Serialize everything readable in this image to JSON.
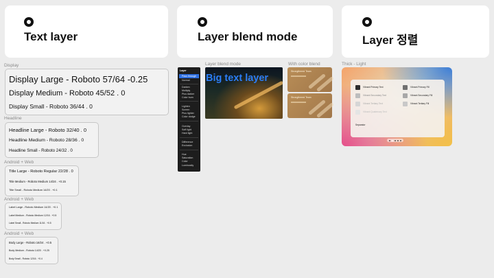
{
  "cards": [
    {
      "title": "Text layer"
    },
    {
      "title": "Layer blend mode"
    },
    {
      "title": "Layer 정렬"
    }
  ],
  "typography": {
    "display": {
      "label": "Display",
      "items": [
        "Display Large - Roboto 57/64 -0.25",
        "Display Medium - Roboto 45/52 .  0",
        "Display Small - Roboto 36/44 . 0"
      ]
    },
    "headline": {
      "label": "Headline",
      "items": [
        "Headline Large - Roboto 32/40 . 0",
        "Headline Medium - Roboto 28/36 . 0",
        "Headline Small - Roboto 24/32 . 0"
      ]
    },
    "title": {
      "label": "Android + Web",
      "items": [
        "Title Large - Roboto Regular 22/28 . 0",
        "Title Medium - Roboto Medium 14/24 . +0.15",
        "Title Small - Roboto Medium 14/20 . +0.1"
      ]
    },
    "label": {
      "label": "Android + Web",
      "items": [
        "Label Large - Roboto Medium 14/20 . +0.1",
        "Label Medium - Roboto Medium 12/16 . +0.5",
        "Label Small - Roboto Medium 11/16 . +0.5"
      ]
    },
    "body": {
      "label": "Android + Web",
      "items": [
        "Body Large - Roboto 16/24 . +0.5",
        "Body Medium - Roboto 14/20 . +0.25",
        "Body Small - Roboto 12/16 . +0.4"
      ]
    }
  },
  "blend": {
    "sidebar_title": "Layer",
    "sidebar_groups": [
      [
        "Pass through",
        "Normal"
      ],
      [
        "Darken",
        "Multiply",
        "Plus darker",
        "Color burn"
      ],
      [
        "Lighten",
        "Screen",
        "Plus lighter",
        "Color dodge"
      ],
      [
        "Overlay",
        "Soft light",
        "Hard light"
      ],
      [
        "Difference",
        "Exclusion"
      ],
      [
        "Hue",
        "Saturation",
        "Color",
        "Luminosity"
      ]
    ],
    "photo_label": "Layer blend mode",
    "photo_text": "Big text layer",
    "color_label": "With color blend",
    "tile_title": "Strongthered Team",
    "accent": "#2b7df5"
  },
  "order": {
    "section_label": "Thick - Light",
    "rows": [
      [
        "Vibrant Primary Text",
        "Vibrant Primary Fill"
      ],
      [
        "Vibrant Secondary Text",
        "Vibrant Secondary Fill"
      ],
      [
        "Vibrant Tertiary Text",
        "Vibrant Tertiary Fill"
      ],
      [
        "Vibrant Quaternary Text",
        ""
      ]
    ],
    "separator": "Separator"
  }
}
